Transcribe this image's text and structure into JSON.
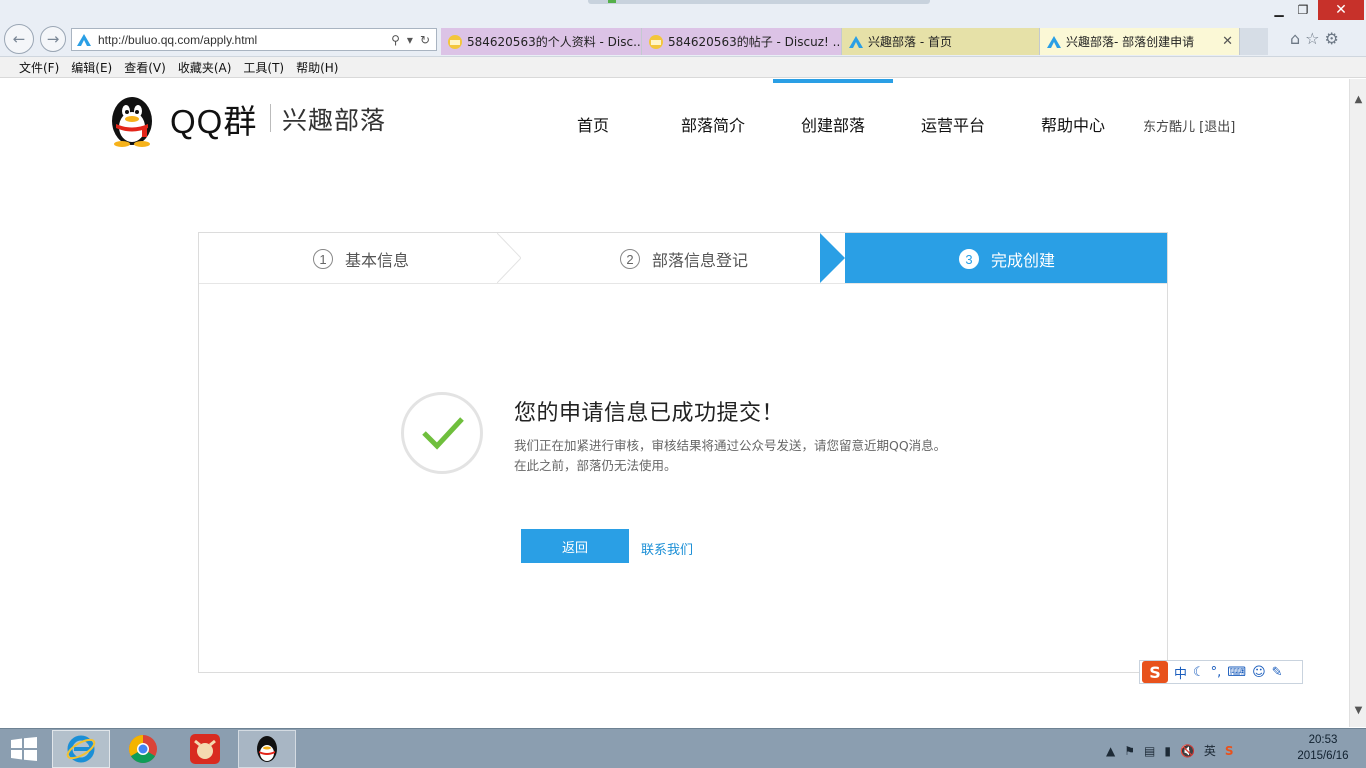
{
  "browser": {
    "url": "http://buluo.qq.com/apply.html",
    "menu": [
      "文件(F)",
      "编辑(E)",
      "查看(V)",
      "收藏夹(A)",
      "工具(T)",
      "帮助(H)"
    ],
    "tabs": [
      {
        "label": "584620563的个人资料 - Disc..."
      },
      {
        "label": "584620563的帖子 - Discuz! ..."
      },
      {
        "label": "兴趣部落 - 首页"
      },
      {
        "label": "兴趣部落- 部落创建申请"
      }
    ],
    "tab_close": "✕",
    "icons": [
      "back-icon",
      "forward-icon",
      "search-icon",
      "refresh-icon",
      "home-icon",
      "favorites-star-icon",
      "settings-gear-icon"
    ]
  },
  "site": {
    "brand_main": "QQ群",
    "brand_sub": "兴趣部落",
    "nav": {
      "home": "首页",
      "intro": "部落简介",
      "create": "创建部落",
      "ops": "运营平台",
      "help": "帮助中心"
    },
    "user": "东方酷儿 [退出]",
    "accent_color": "#2a9fe5"
  },
  "steps": [
    {
      "num": "1",
      "label": "基本信息"
    },
    {
      "num": "2",
      "label": "部落信息登记"
    },
    {
      "num": "3",
      "label": "完成创建"
    }
  ],
  "result": {
    "title": "您的申请信息已成功提交！",
    "desc_line1": "我们正在加紧进行审核，审核结果将通过公众号发送，请您留意近期QQ消息。",
    "desc_line2": "在此之前，部落仍无法使用。",
    "back_button": "返回",
    "contact_link": "联系我们"
  },
  "ime": {
    "logo": "S",
    "mode": "中"
  },
  "taskbar": {
    "time": "20:53",
    "date": "2015/6/16",
    "ime_tray": "英"
  }
}
